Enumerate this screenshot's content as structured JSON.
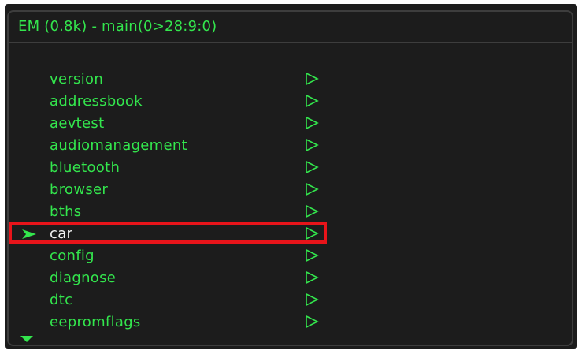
{
  "window": {
    "title": "EM (0.8k) - main(0>28:9:0)"
  },
  "colors": {
    "text_green": "#33e64d",
    "selected_text": "#f2f2f2",
    "background": "#1c1c1c",
    "border": "#3d3d3d",
    "highlight": "#e8141a"
  },
  "menu": {
    "selected_index": 7,
    "items": [
      {
        "label": "version",
        "icon": "play-outline-icon"
      },
      {
        "label": "addressbook",
        "icon": "play-outline-icon"
      },
      {
        "label": "aevtest",
        "icon": "play-outline-icon"
      },
      {
        "label": "audiomanagement",
        "icon": "play-outline-icon"
      },
      {
        "label": "bluetooth",
        "icon": "play-outline-icon"
      },
      {
        "label": "browser",
        "icon": "play-outline-icon"
      },
      {
        "label": "bths",
        "icon": "play-outline-icon"
      },
      {
        "label": "car",
        "icon": "play-outline-icon"
      },
      {
        "label": "config",
        "icon": "play-outline-icon"
      },
      {
        "label": "diagnose",
        "icon": "play-outline-icon"
      },
      {
        "label": "dtc",
        "icon": "play-outline-icon"
      },
      {
        "label": "eepromflags",
        "icon": "play-outline-icon"
      }
    ]
  },
  "icons": {
    "selection_marker": "arrow-right-filled-icon",
    "scroll_indicator": "triangle-down-filled-icon"
  }
}
